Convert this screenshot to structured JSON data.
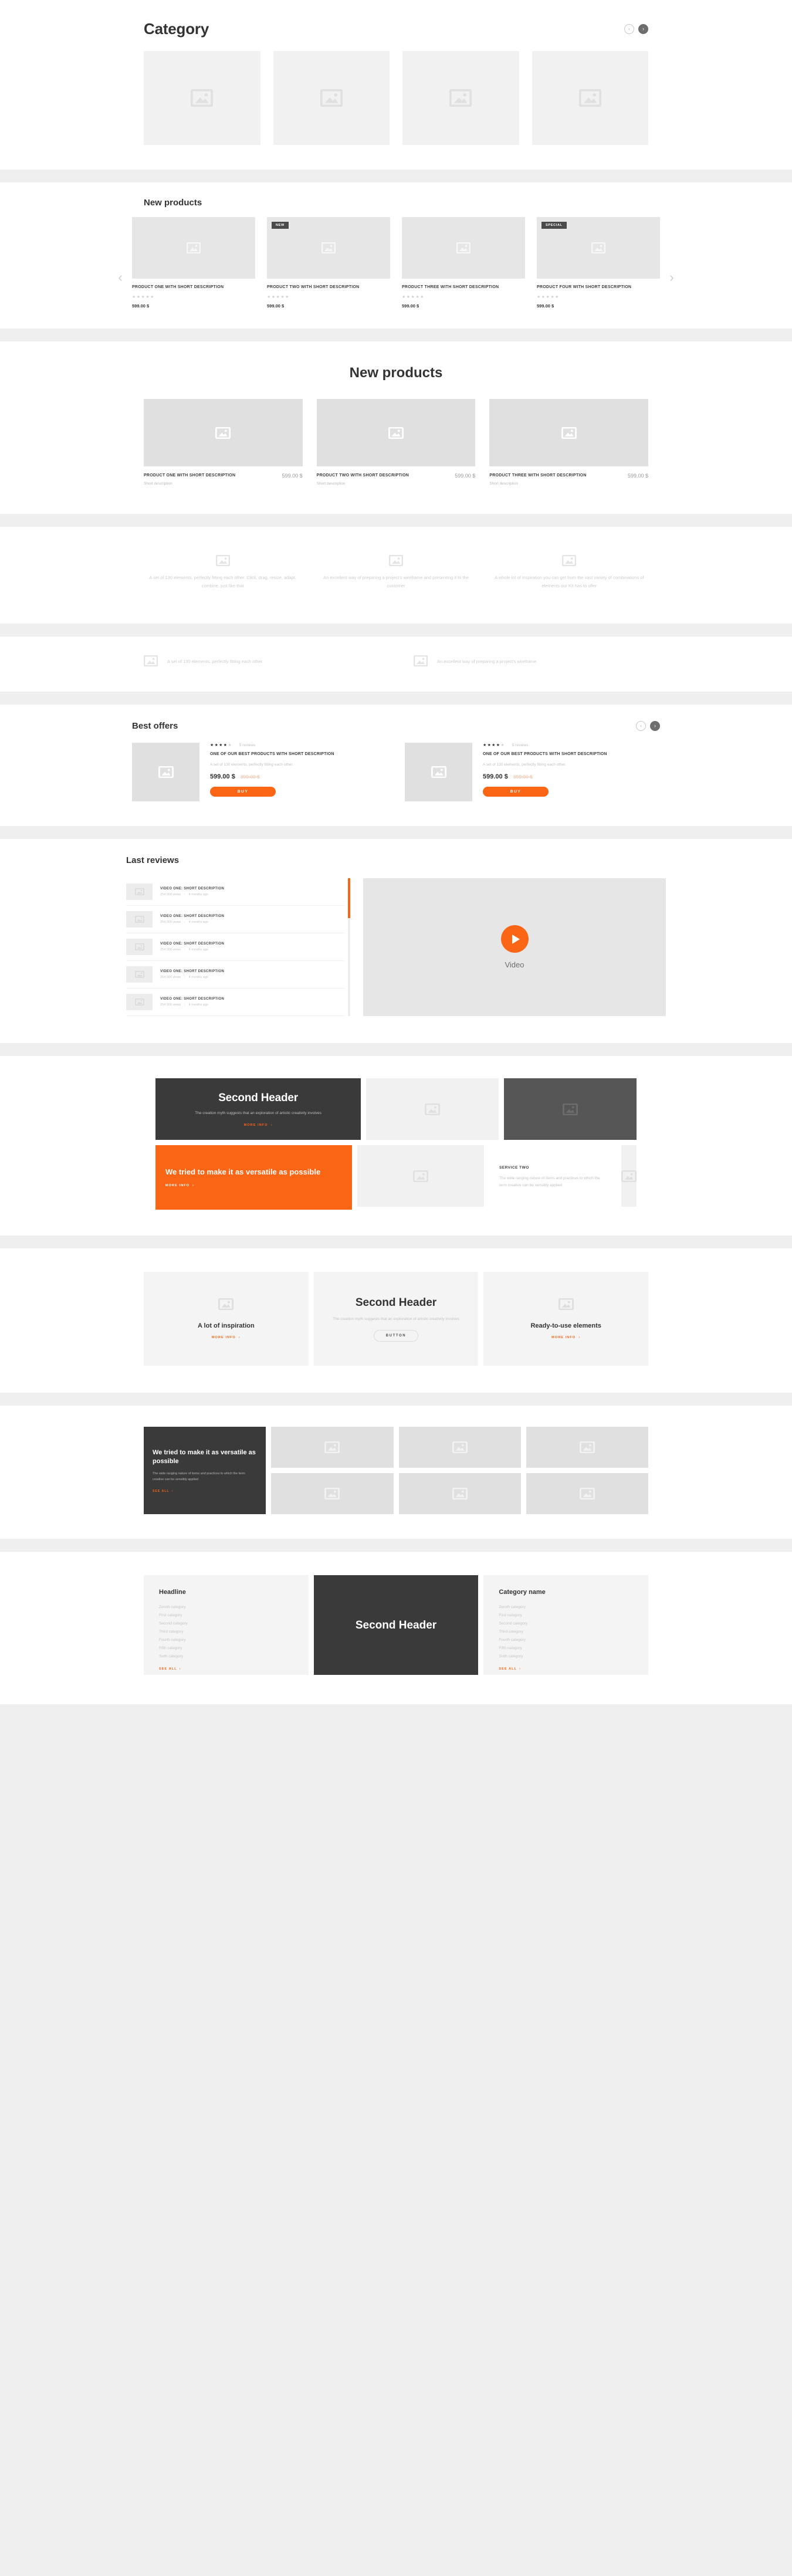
{
  "colors": {
    "accent": "#fb6516",
    "dark": "#3a3a3a",
    "placeholder": "#e6e6e6",
    "muted": "#c5c5c5"
  },
  "category": {
    "title": "Category",
    "prev_icon": "chevron-left-icon",
    "next_icon": "chevron-right-icon",
    "tiles": [
      "image-placeholder",
      "image-placeholder",
      "image-placeholder",
      "image-placeholder"
    ]
  },
  "new_products_carousel": {
    "title": "New products",
    "prev_label": "‹",
    "next_label": "›",
    "products": [
      {
        "name": "Product one with short description",
        "price": "599.00 $",
        "rating": 0,
        "badge": ""
      },
      {
        "name": "Product two with short description",
        "price": "599.00 $",
        "rating": 0,
        "badge": "NEW"
      },
      {
        "name": "Product three with short description",
        "price": "599.00 $",
        "rating": 0,
        "badge": ""
      },
      {
        "name": "Product four with short description",
        "price": "599.00 $",
        "rating": 0,
        "badge": "SPECIAL"
      }
    ]
  },
  "new_products_big": {
    "title": "New products",
    "products": [
      {
        "name": "Product one with short description",
        "desc": "Short description",
        "price": "599.00 $"
      },
      {
        "name": "Product two with short description",
        "desc": "Short description",
        "price": "599.00 $"
      },
      {
        "name": "Product three with short description",
        "desc": "Short description",
        "price": "599.00 $"
      }
    ]
  },
  "features_three": [
    {
      "text": "A set of 130 elements, perfectly fitting each other. Click, drag, resize, adapt, combine, just like that"
    },
    {
      "text": "An excellent way of preparing a project's wireframe and presenting it to the customer"
    },
    {
      "text": "A whole lot of inspiration you can get from the vast variety of combinations of elements our Kit has to offer"
    }
  ],
  "features_two": [
    {
      "text": "A set of 130 elements, perfectly fitting each other."
    },
    {
      "text": "An excellent way of preparing a project's wireframe"
    }
  ],
  "best_offers": {
    "title": "Best offers",
    "offers": [
      {
        "rating": 4,
        "reviews": "5 reviews",
        "name": "One of our best products with short description",
        "desc": "A set of 130 elements, perfectly fitting each other.",
        "price": "599.00 $",
        "old_price": "399.00 $",
        "buy_label": "BUY"
      },
      {
        "rating": 4,
        "reviews": "5 reviews",
        "name": "One of our best products with short description",
        "desc": "A set of 130 elements, perfectly fitting each other.",
        "price": "599.00 $",
        "old_price": "399.00 $",
        "buy_label": "BUY"
      }
    ]
  },
  "last_reviews": {
    "title": "Last reviews",
    "items": [
      {
        "name": "Video one: short description",
        "views": "254 000 views",
        "age": "4 months ago"
      },
      {
        "name": "Video one: short description",
        "views": "254 000 views",
        "age": "4 months ago"
      },
      {
        "name": "Video one: short description",
        "views": "254 000 views",
        "age": "4 months ago"
      },
      {
        "name": "Video one: short description",
        "views": "254 000 views",
        "age": "4 months ago"
      },
      {
        "name": "Video one: short description",
        "views": "254 000 views",
        "age": "4 months ago"
      }
    ],
    "video_label": "Video",
    "play_icon": "play-icon"
  },
  "dark_blocks": {
    "header": "Second Header",
    "header_desc": "The creation myth suggests that an exploration of artistic creativity involves",
    "more_info": "MORE INFO",
    "orange": {
      "title": "We tried to make it as versatile as possible",
      "more_info": "MORE INFO"
    },
    "service": {
      "title": "Service two",
      "text": "The wide ranging nature of items and practices to which the term creative can be sensibly applied"
    }
  },
  "inspiration": {
    "left": {
      "title": "A lot of inspiration",
      "more_info": "MORE INFO"
    },
    "middle": {
      "title": "Second Header",
      "desc": "The creation myth suggests that an exploration of artistic creativity involves",
      "button": "BUTTON"
    },
    "right": {
      "title": "Ready-to-use elements",
      "more_info": "MORE INFO"
    }
  },
  "versatile": {
    "title": "We tried to make it as versatile as possible",
    "desc": "The wide ranging nature of items and practices to which the term creative can be sensibly applied",
    "see_all": "SEE ALL"
  },
  "footer": {
    "left": {
      "title": "Headline",
      "links": [
        "Zeroth category",
        "First category",
        "Second category",
        "Third category",
        "Fourth category",
        "Fifth category",
        "Sixth category"
      ],
      "see_all": "SEE ALL"
    },
    "middle": {
      "title": "Second Header"
    },
    "right": {
      "title": "Category name",
      "links": [
        "Zeroth category",
        "First category",
        "Second category",
        "Third category",
        "Fourth category",
        "Fifth category",
        "Sixth category"
      ],
      "see_all": "SEE ALL"
    }
  }
}
